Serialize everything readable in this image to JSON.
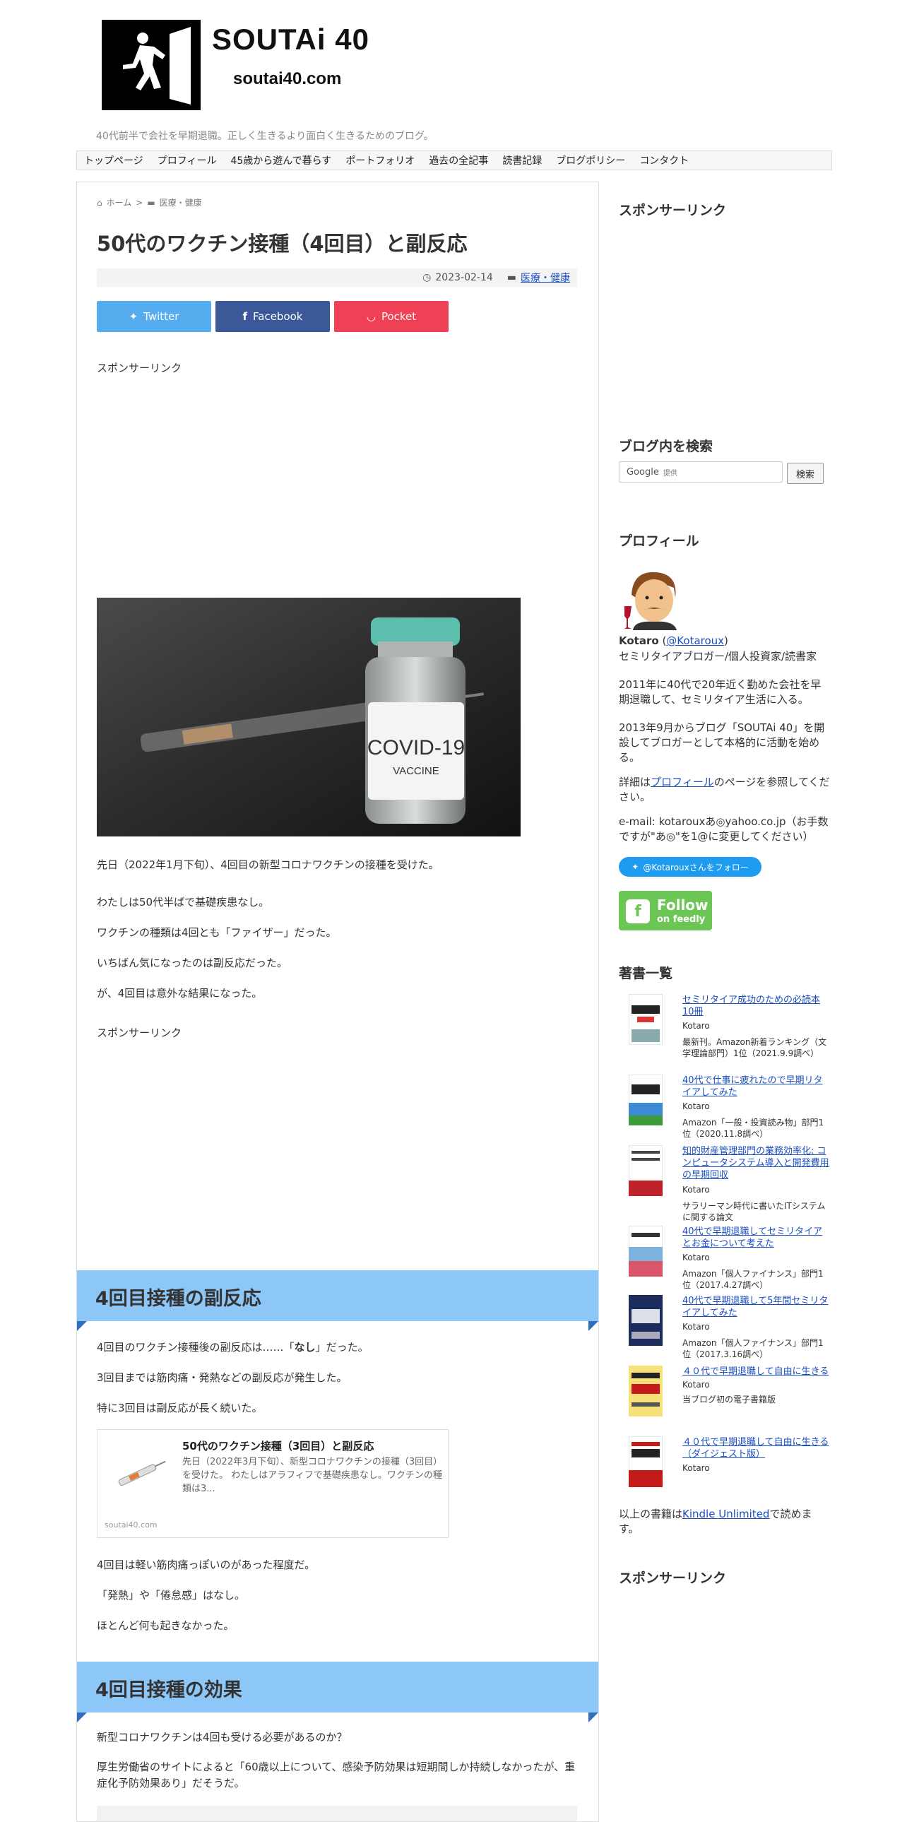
{
  "header": {
    "site_title": "SOUTAi 40",
    "site_domain": "soutai40.com",
    "tagline": "40代前半で会社を早期退職。正しく生きるより面白く生きるためのブログ。"
  },
  "nav": [
    "トップページ",
    "プロフィール",
    "45歳から遊んで暮らす",
    "ポートフォリオ",
    "過去の全記事",
    "読書記録",
    "ブログポリシー",
    "コンタクト"
  ],
  "breadcrumb": {
    "home": "ホーム",
    "separator": ">",
    "category": "医療・健康"
  },
  "article": {
    "title": "50代のワクチン接種（4回目）と副反応",
    "date": "2023-02-14",
    "category": "医療・健康",
    "share": {
      "twitter": "Twitter",
      "facebook": "Facebook",
      "pocket": "Pocket"
    },
    "sponsor_label": "スポンサーリンク",
    "vaccine_label_1": "COVID-19",
    "vaccine_label_2": "VACCINE",
    "intro": [
      "先日（2022年1月下旬）、4回目の新型コロナワクチンの接種を受けた。",
      "わたしは50代半ばで基礎疾患なし。",
      "ワクチンの種類は4回とも「ファイザー」だった。",
      "いちばん気になったのは副反応だった。",
      "が、4回目は意外な結果になった。"
    ],
    "sponsor_label_2": "スポンサーリンク",
    "section1": {
      "heading": "4回目接種の副反応",
      "p1_before": "4回目のワクチン接種後の副反応は……「",
      "p1_bold": "なし",
      "p1_after": "」だった。",
      "p2": "3回目までは筋肉痛・発熱などの副反応が発生した。",
      "p3": "特に3回目は副反応が長く続いた。",
      "card": {
        "title": "50代のワクチン接種（3回目）と副反応",
        "desc": "先日（2022年3月下旬）、新型コロナワクチンの接種（3回目）を受けた。 わたしはアラフィフで基礎疾患なし。ワクチンの種類は3...",
        "site": "soutai40.com"
      },
      "p4": "4回目は軽い筋肉痛っぽいのがあった程度だ。",
      "p5": "「発熱」や「倦怠感」はなし。",
      "p6": "ほとんど何も起きなかった。"
    },
    "section2": {
      "heading": "4回目接種の効果",
      "p1": "新型コロナワクチンは4回も受ける必要があるのか？",
      "p2": "厚生労働省のサイトによると「60歳以上について、感染予防効果は短期間しか持続しなかったが、重症化予防効果あり」だそうだ。"
    }
  },
  "sidebar": {
    "sponsor_heading": "スポンサーリンク",
    "search_heading": "ブログ内を検索",
    "search_google": "Google",
    "search_placeholder": "提供",
    "search_button": "検索",
    "profile_heading": "プロフィール",
    "profile_name": "Kotaro",
    "profile_handle": "@Kotaroux",
    "profile_role": "セミリタイアブロガー/個人投資家/読書家",
    "profile_p1": "2011年に40代で20年近く勤めた会社を早期退職して、セミリタイア生活に入る。",
    "profile_p2": "2013年9月からブログ「SOUTAi 40」を開設してブロガーとして本格的に活動を始める。",
    "profile_p3_before": "詳細は",
    "profile_p3_link": "プロフィール",
    "profile_p3_after": "のページを参照してください。",
    "profile_email": "e-mail: kotarouxあ◎yahoo.co.jp（お手数ですが\"あ◎\"を1@に変更してください）",
    "twitter_follow": "@Kotarouxさんをフォロー",
    "feedly_1": "Follow",
    "feedly_2": "on feedly",
    "books_heading": "著書一覧",
    "books": [
      {
        "title": "セミリタイア成功のための必読本10冊",
        "author": "Kotaro",
        "note": "最新刊。Amazon新着ランキング（文学理論部門）1位（2021.9.9調べ）"
      },
      {
        "title": "40代で仕事に疲れたので早期リタイアしてみた",
        "author": "Kotaro",
        "note": "Amazon「一般・投資読み物」部門1位（2020.11.8調べ）"
      },
      {
        "title": "知的財産管理部門の業務効率化: コンピュータシステム導入と開発費用の早期回収",
        "author": "Kotaro",
        "note": "サラリーマン時代に書いたITシステムに関する論文"
      },
      {
        "title": "40代で早期退職してセミリタイアとお金について考えた",
        "author": "Kotaro",
        "note": "Amazon「個人ファイナンス」部門1位（2017.4.27調べ）"
      },
      {
        "title": "40代で早期退職して5年間セミリタイアしてみた",
        "author": "Kotaro",
        "note": "Amazon「個人ファイナンス」部門1位（2017.3.16調べ）"
      },
      {
        "title": "４０代で早期退職して自由に生きる",
        "author": "Kotaro",
        "note": "当ブログ初の電子書籍版"
      },
      {
        "title": "４０代で早期退職して自由に生きる（ダイジェスト版）",
        "author": "Kotaro",
        "note": ""
      }
    ],
    "kindle_before": "以上の書籍は",
    "kindle_link": "Kindle Unlimited",
    "kindle_after": "で読めます。",
    "sponsor_heading_2": "スポンサーリンク"
  }
}
